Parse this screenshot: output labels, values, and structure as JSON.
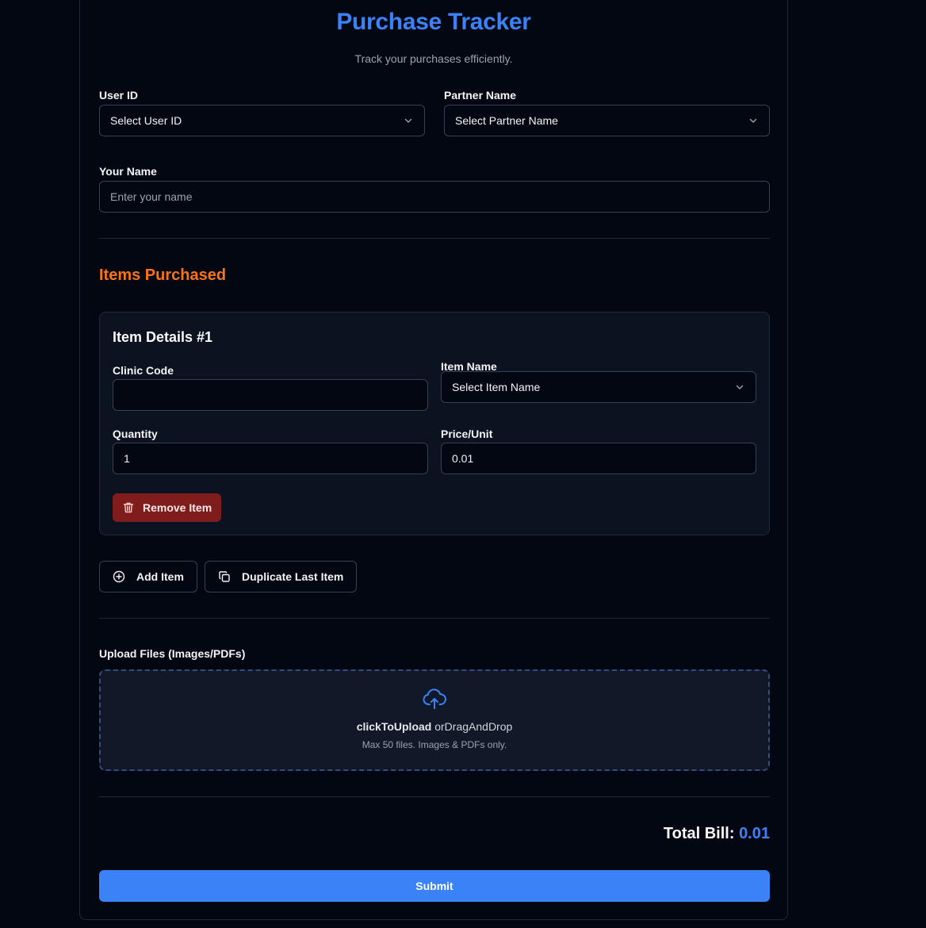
{
  "header": {
    "title": "Purchase Tracker",
    "subtitle": "Track your purchases efficiently."
  },
  "form": {
    "user_id": {
      "label": "User ID",
      "value": "Select User ID",
      "icon": "chevron-down-icon"
    },
    "partner_name": {
      "label": "Partner Name",
      "value": "Select Partner Name",
      "icon": "chevron-down-icon"
    },
    "your_name": {
      "label": "Your Name",
      "placeholder": "Enter your name",
      "value": ""
    }
  },
  "items_section": {
    "title": "Items Purchased",
    "items": [
      {
        "title": "Item Details #1",
        "clinic_code": {
          "label": "Clinic Code",
          "value": ""
        },
        "item_name": {
          "label": "Item Name",
          "value": "Select Item Name",
          "icon": "chevron-down-icon"
        },
        "quantity": {
          "label": "Quantity",
          "value": "1"
        },
        "price_unit": {
          "label": "Price/Unit",
          "value": "0.01"
        },
        "remove_label": "Remove Item",
        "remove_icon": "trash-icon"
      }
    ],
    "add_label": "Add Item",
    "add_icon": "plus-circle-icon",
    "duplicate_label": "Duplicate Last Item",
    "duplicate_icon": "copy-icon"
  },
  "upload": {
    "label": "Upload Files (Images/PDFs)",
    "icon": "cloud-upload-icon",
    "click_text": "clickToUpload",
    "drag_text": "orDragAndDrop",
    "hint": "Max 50 files. Images & PDFs only."
  },
  "summary": {
    "total_label": "Total Bill:",
    "total_value": "0.01"
  },
  "submit_label": "Submit",
  "colors": {
    "background": "#030712",
    "accent": "#3b82f6",
    "section_title": "#f97316",
    "danger": "#7f1d1d"
  }
}
